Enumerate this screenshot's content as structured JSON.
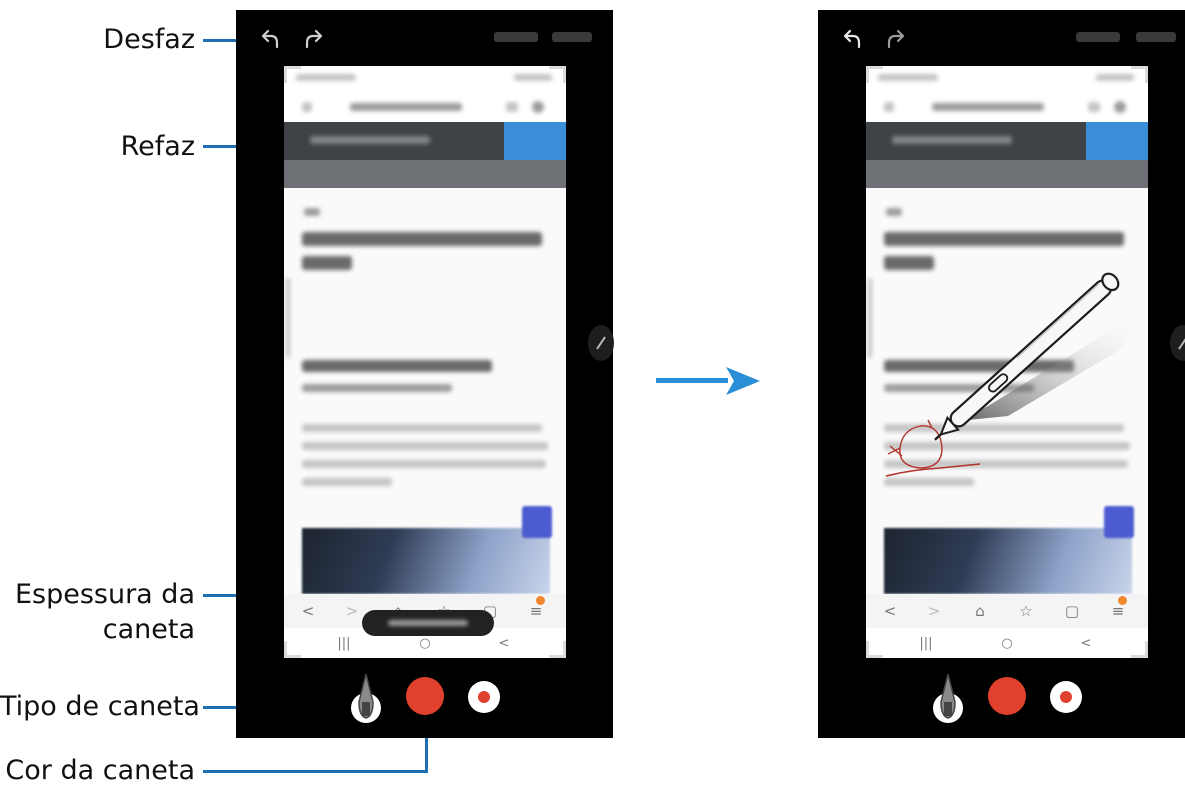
{
  "callouts": {
    "undo": "Desfaz",
    "redo": "Refaz",
    "thickness_line1": "Espessura da",
    "thickness_line2": "caneta",
    "pen_type": "Tipo de caneta",
    "pen_color": "Cor da caneta"
  },
  "icons": {
    "undo": "undo-icon",
    "redo": "redo-icon",
    "arrow": "right-arrow-icon",
    "pen_tip": "pen-tip-icon",
    "spen": "s-pen-illustration"
  },
  "colors": {
    "callout_line": "#1f6eb4",
    "pen_color": "#e0412f",
    "arrow": "#2a8fd6",
    "handwriting": "#b2342c"
  },
  "browser_bar_icons": [
    "<",
    ">",
    "⌂",
    "☆",
    "▢",
    "≡"
  ],
  "system_nav_icons": [
    "|||",
    "○",
    "<"
  ]
}
